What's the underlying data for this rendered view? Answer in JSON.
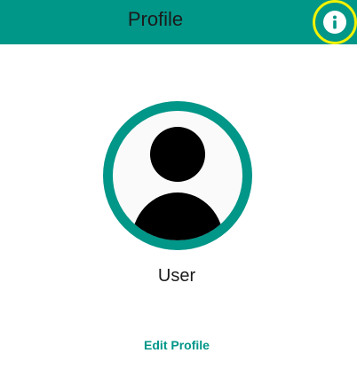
{
  "app_bar": {
    "title": "Profile",
    "info_icon": "info-icon"
  },
  "profile": {
    "avatar_icon": "person-silhouette-icon",
    "name": "User",
    "edit_label": "Edit Profile"
  },
  "colors": {
    "primary": "#009688",
    "highlight": "#f2f200",
    "text": "#1b1b1b"
  }
}
